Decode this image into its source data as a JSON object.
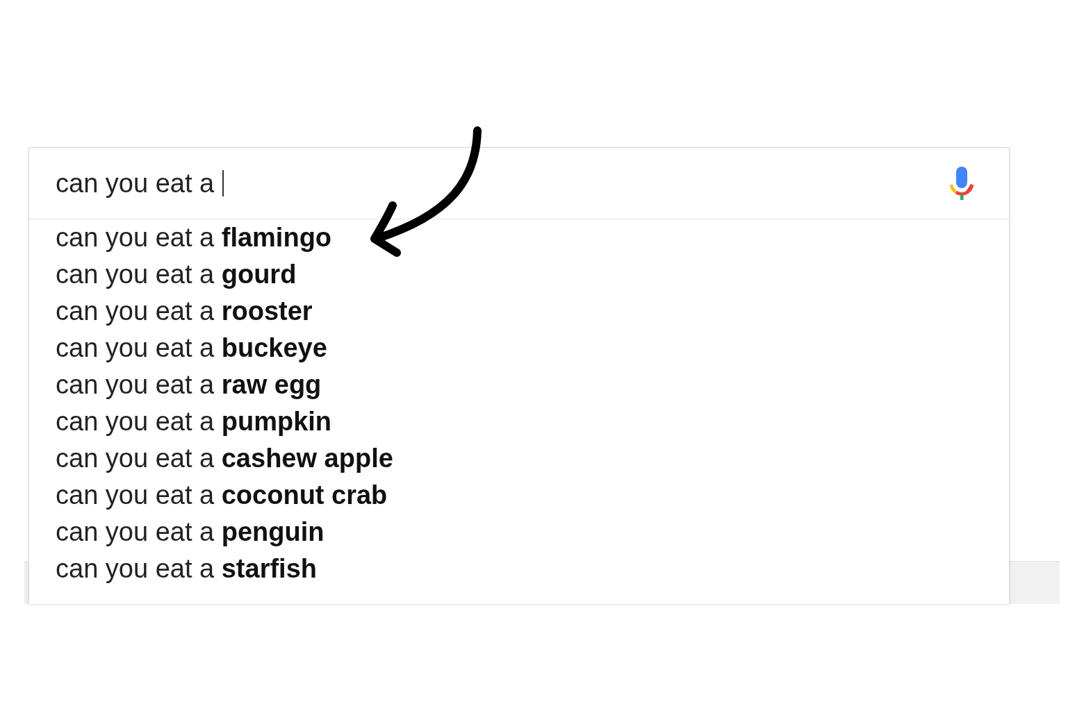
{
  "search": {
    "value": "can you eat a",
    "focused": true
  },
  "suggestions": [
    "can you eat a **flamingo**",
    "can you eat a **gourd**",
    "can you eat a **rooster**",
    "can you eat a **buckeye**",
    "can you eat a **raw egg**",
    "can you eat a **pumpkin**",
    "can you eat a **cashew apple**",
    "can you eat a **coconut crab**",
    "can you eat a **penguin**",
    "can you eat a **starfish**"
  ]
}
